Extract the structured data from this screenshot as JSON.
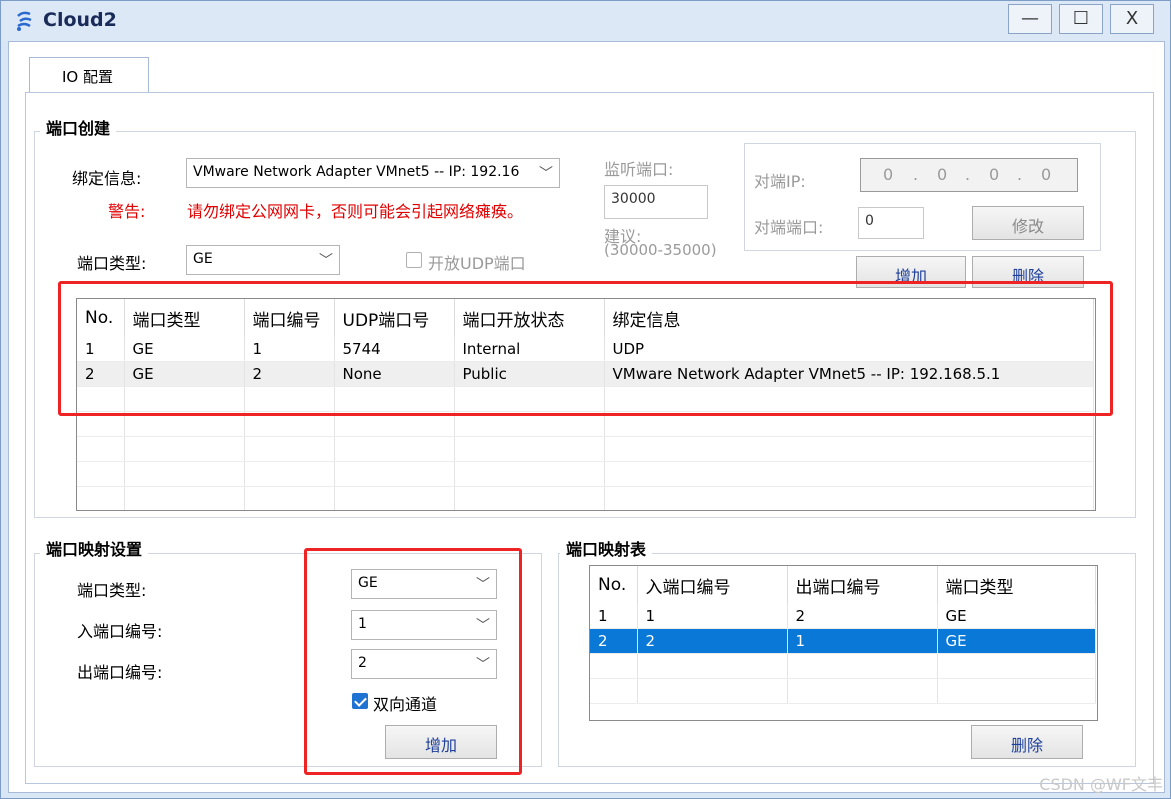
{
  "window": {
    "title": "Cloud2",
    "controls": {
      "minimize": "—",
      "maximize": "☐",
      "close": "X"
    }
  },
  "tabs": [
    {
      "label": "IO 配置"
    }
  ],
  "port_creation": {
    "title": "端口创建",
    "bind_label": "绑定信息:",
    "bind_value": "VMware Network Adapter VMnet5 -- IP: 192.16",
    "warning_label": "警告:",
    "warning_text": "请勿绑定公网网卡，否则可能会引起网络瘫痪。",
    "port_type_label": "端口类型:",
    "port_type_value": "GE",
    "open_udp_label": "开放UDP端口",
    "open_udp_checked": false,
    "listen_port_label": "监听端口:",
    "listen_port_value": "30000",
    "suggest_label": "建议:",
    "suggest_range": "(30000-35000)",
    "peer_ip_label": "对端IP:",
    "peer_ip_octets": [
      "0",
      "0",
      "0",
      "0"
    ],
    "peer_port_label": "对端端口:",
    "peer_port_value": "0",
    "modify_label": "修改",
    "add_label": "增加",
    "delete_label": "删除"
  },
  "port_table": {
    "headers": [
      "No.",
      "端口类型",
      "端口编号",
      "UDP端口号",
      "端口开放状态",
      "绑定信息"
    ],
    "rows": [
      [
        "1",
        "GE",
        "1",
        "5744",
        "Internal",
        "UDP"
      ],
      [
        "2",
        "GE",
        "2",
        "None",
        "Public",
        "VMware Network Adapter VMnet5 -- IP: 192.168.5.1"
      ]
    ]
  },
  "mapping_settings": {
    "title": "端口映射设置",
    "port_type_label": "端口类型:",
    "port_type_value": "GE",
    "in_port_label": "入端口编号:",
    "in_port_value": "1",
    "out_port_label": "出端口编号:",
    "out_port_value": "2",
    "bidirectional_label": "双向通道",
    "bidirectional_checked": true,
    "add_label": "增加"
  },
  "mapping_table": {
    "title": "端口映射表",
    "headers": [
      "No.",
      "入端口编号",
      "出端口编号",
      "端口类型"
    ],
    "rows": [
      [
        "1",
        "1",
        "2",
        "GE"
      ],
      [
        "2",
        "2",
        "1",
        "GE"
      ]
    ],
    "selected_row": 1,
    "delete_label": "删除"
  },
  "watermark": "CSDN @WF文丰",
  "colors": {
    "highlight_box": "#ee2424",
    "selection": "#0a78d7",
    "warning": "#e00000"
  }
}
